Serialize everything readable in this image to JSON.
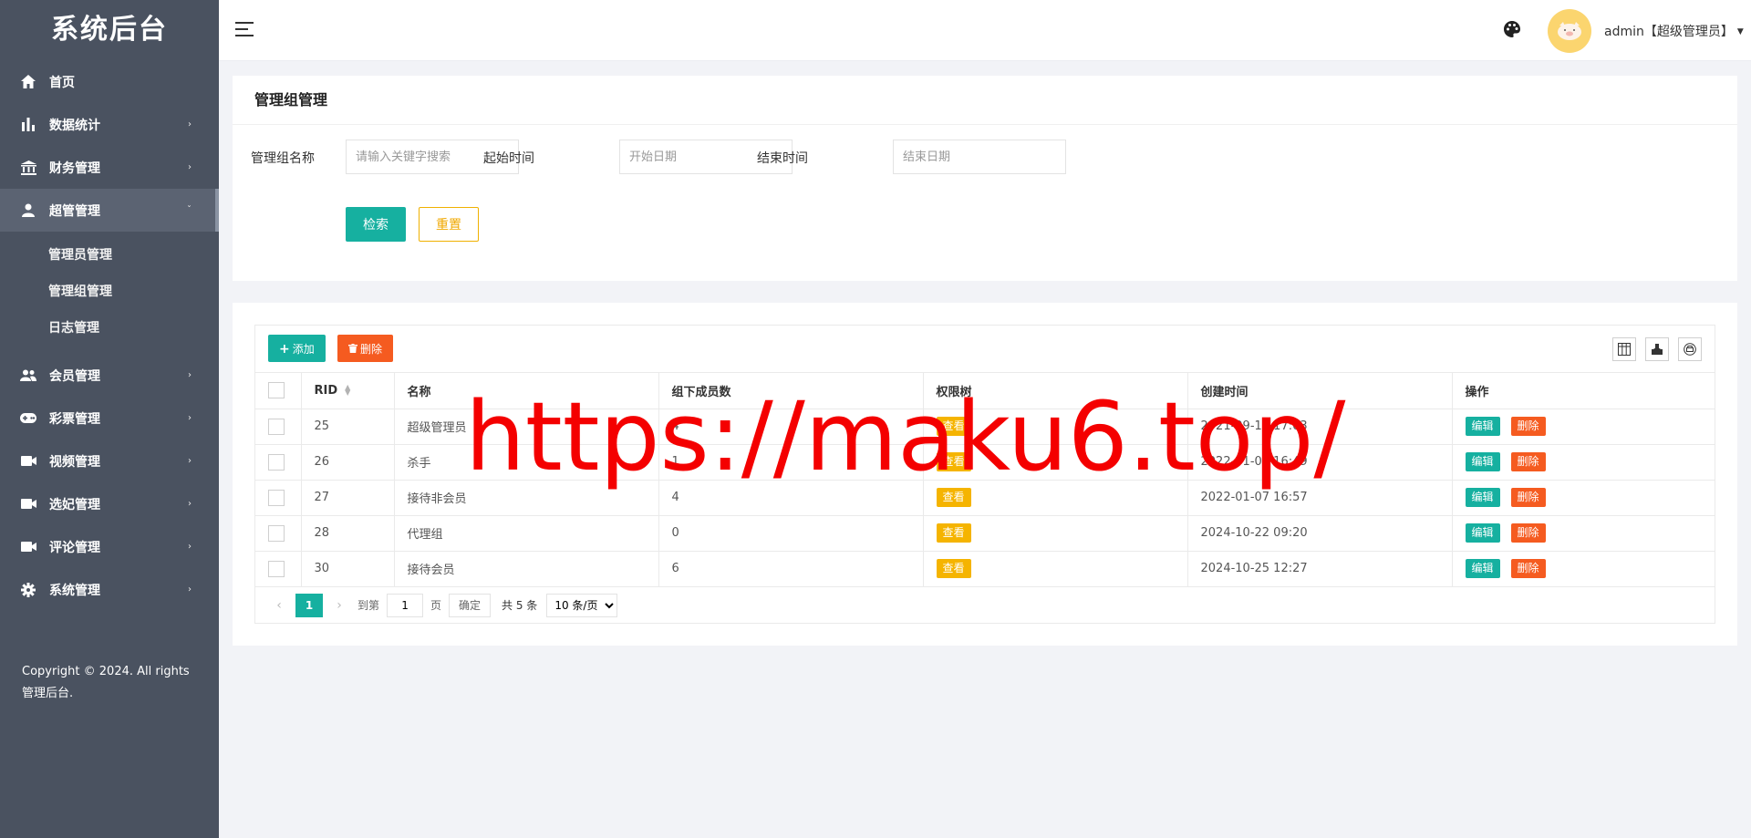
{
  "sidebar": {
    "brand": "系统后台",
    "items": [
      {
        "label": "首页",
        "icon": "home-icon"
      },
      {
        "label": "数据统计",
        "icon": "bar-chart-icon"
      },
      {
        "label": "财务管理",
        "icon": "bank-icon"
      },
      {
        "label": "超管管理",
        "icon": "user-icon"
      },
      {
        "label": "会员管理",
        "icon": "users-icon"
      },
      {
        "label": "彩票管理",
        "icon": "gamepad-icon"
      },
      {
        "label": "视频管理",
        "icon": "video-icon"
      },
      {
        "label": "选妃管理",
        "icon": "video-icon"
      },
      {
        "label": "评论管理",
        "icon": "video-icon"
      },
      {
        "label": "系统管理",
        "icon": "gear-icon"
      }
    ],
    "submenu": [
      "管理员管理",
      "管理组管理",
      "日志管理"
    ],
    "copyright": "Copyright © 2024. All rights 管理后台."
  },
  "header": {
    "user": "admin【超级管理员】"
  },
  "search": {
    "title": "管理组管理",
    "name_label": "管理组名称",
    "name_placeholder": "请输入关键字搜索",
    "start_label": "起始时间",
    "start_placeholder": "开始日期",
    "end_label": "结束时间",
    "end_placeholder": "结束日期",
    "search_button": "检索",
    "reset_button": "重置"
  },
  "toolbar": {
    "add_label": "添加",
    "delete_label": "删除"
  },
  "table": {
    "columns": [
      "RID",
      "名称",
      "组下成员数",
      "权限树",
      "创建时间",
      "操作"
    ],
    "view_label": "查看",
    "edit_label": "编辑",
    "delete_label": "删除",
    "rows": [
      {
        "rid": "25",
        "name": "超级管理员",
        "members": "4",
        "created": "2021-09-16 17:03"
      },
      {
        "rid": "26",
        "name": "杀手",
        "members": "1",
        "created": "2022-01-07 16:49"
      },
      {
        "rid": "27",
        "name": "接待非会员",
        "members": "4",
        "created": "2022-01-07 16:57"
      },
      {
        "rid": "28",
        "name": "代理组",
        "members": "0",
        "created": "2024-10-22 09:20"
      },
      {
        "rid": "30",
        "name": "接待会员",
        "members": "6",
        "created": "2024-10-25 12:27"
      }
    ]
  },
  "pager": {
    "current": "1",
    "goto_label": "到第",
    "goto_value": "1",
    "page_label": "页",
    "confirm_label": "确定",
    "total": "共 5 条",
    "page_size": "10 条/页"
  },
  "watermark": "https://maku6.top/",
  "colors": {
    "sidebar_bg": "#4a5260",
    "accent": "#16b0a0",
    "danger": "#f55b20",
    "warning": "#f5b400",
    "watermark": "#f40000"
  }
}
